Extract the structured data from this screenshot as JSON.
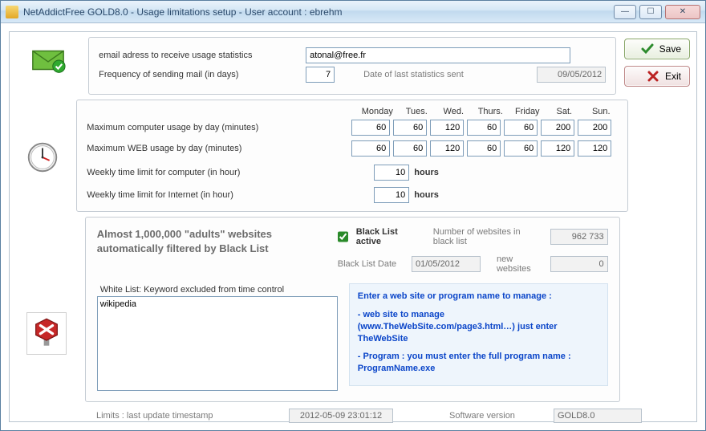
{
  "window": {
    "title": "NetAddictFree  GOLD8.0 - Usage limitations setup - User account : ebrehm"
  },
  "buttons": {
    "save": "Save",
    "exit": "Exit"
  },
  "email": {
    "label": "email adress to receive usage statistics",
    "value": "atonal@free.fr",
    "freq_label": "Frequency of sending mail (in days)",
    "freq_value": "7",
    "last_sent_label": "Date of last statistics sent",
    "last_sent_value": "09/05/2012"
  },
  "days": {
    "headers": [
      "Monday",
      "Tues.",
      "Wed.",
      "Thurs.",
      "Friday",
      "Sat.",
      "Sun."
    ],
    "comp_label": "Maximum computer usage by day (minutes)",
    "comp": [
      "60",
      "60",
      "120",
      "60",
      "60",
      "200",
      "200"
    ],
    "web_label": "Maximum WEB usage by day (minutes)",
    "web": [
      "60",
      "60",
      "120",
      "60",
      "60",
      "120",
      "120"
    ],
    "wk_comp_label": "Weekly time limit for computer (in hour)",
    "wk_comp": "10",
    "wk_net_label": "Weekly time limit for Internet (in hour)",
    "wk_net": "10",
    "hours": "hours"
  },
  "blacklist": {
    "headline": "Almost 1,000,000 \"adults\" websites automatically filtered by Black List",
    "active_label": "Black List active",
    "active": true,
    "count_label": "Number of websites in black list",
    "count": "962 733",
    "date_label": "Black List Date",
    "date": "01/05/2012",
    "new_label": "new websites",
    "new_count": "0",
    "wl_label": "White List: Keyword excluded from time control",
    "wl_text": "wikipedia",
    "help1": "Enter a web site or program name to manage :",
    "help2": "- web site to manage (www.TheWebSite.com/page3.html…) just enter TheWebSite",
    "help3": "- Program : you must enter the full program name : ProgramName.exe"
  },
  "footer": {
    "ts_label": "Limits : last update timestamp",
    "ts": "2012-05-09 23:01:12",
    "ver_label": "Software version",
    "ver": "GOLD8.0"
  }
}
